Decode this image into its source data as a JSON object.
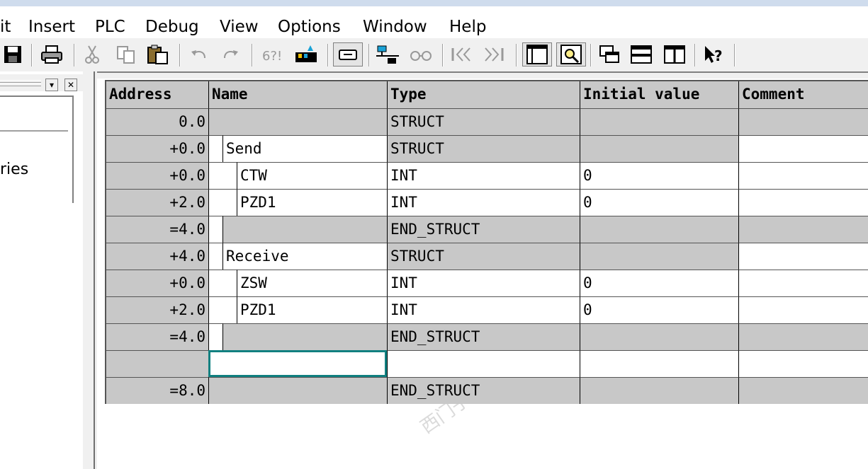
{
  "menu": {
    "items": [
      "it",
      "Insert",
      "PLC",
      "Debug",
      "View",
      "Options",
      "Window",
      "Help"
    ]
  },
  "toolbar": {
    "buttons": [
      "save-icon",
      "print-icon",
      "cut-icon",
      "copy-icon",
      "paste-icon",
      "undo-icon",
      "redo-icon",
      "monitor-variables-icon",
      "module-info-icon",
      "declaration-view-icon",
      "network-icon",
      "glasses-icon",
      "first-icon",
      "prev-icon",
      "next-icon",
      "last-icon",
      "data-view-icon",
      "zoom-view-icon",
      "overview-icon",
      "split-horizontal-icon",
      "split-vertical-icon",
      "context-help-icon"
    ]
  },
  "left_pane": {
    "label": "ries"
  },
  "table": {
    "headers": {
      "address": "Address",
      "name": "Name",
      "type": "Type",
      "initial_value": "Initial value",
      "comment": "Comment"
    },
    "rows": [
      {
        "address": "0.0",
        "name": "",
        "type": "STRUCT",
        "initial": "",
        "comment": ""
      },
      {
        "address": "+0.0",
        "name": "Send",
        "type": "STRUCT",
        "initial": "",
        "comment": ""
      },
      {
        "address": "+0.0",
        "name": "CTW",
        "type": "INT",
        "initial": "0",
        "comment": ""
      },
      {
        "address": "+2.0",
        "name": "PZD1",
        "type": "INT",
        "initial": "0",
        "comment": ""
      },
      {
        "address": "=4.0",
        "name": "",
        "type": "END_STRUCT",
        "initial": "",
        "comment": ""
      },
      {
        "address": "+4.0",
        "name": "Receive",
        "type": "STRUCT",
        "initial": "",
        "comment": ""
      },
      {
        "address": "+0.0",
        "name": "ZSW",
        "type": "INT",
        "initial": "0",
        "comment": ""
      },
      {
        "address": "+2.0",
        "name": "PZD1",
        "type": "INT",
        "initial": "0",
        "comment": ""
      },
      {
        "address": "=4.0",
        "name": "",
        "type": "END_STRUCT",
        "initial": "",
        "comment": ""
      },
      {
        "address": "",
        "name": "",
        "type": "",
        "initial": "",
        "comment": ""
      },
      {
        "address": "=8.0",
        "name": "",
        "type": "END_STRUCT",
        "initial": "",
        "comment": ""
      }
    ]
  },
  "colors": {
    "grid_gray": "#c8c8c8",
    "selection": "#118080"
  }
}
